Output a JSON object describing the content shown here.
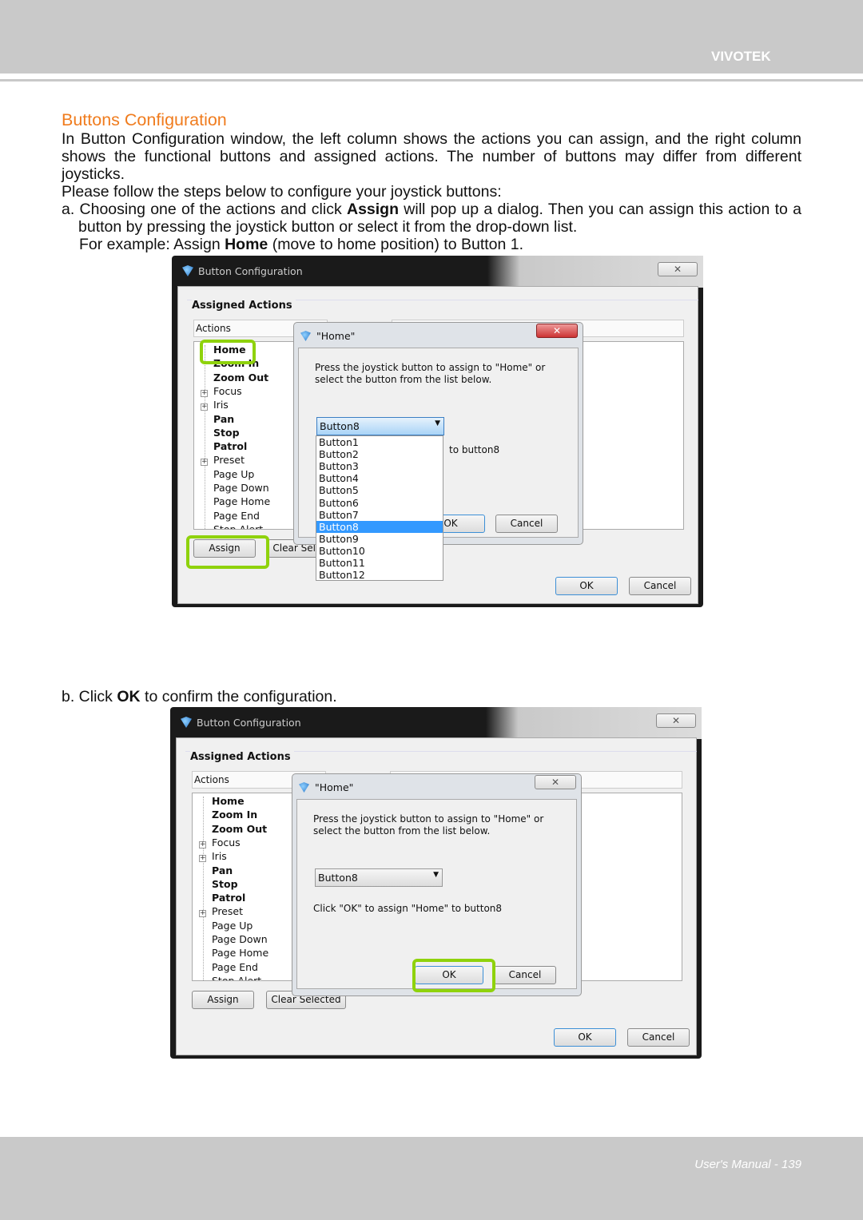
{
  "header": {
    "brand": "VIVOTEK"
  },
  "footer": {
    "page_label": "User's Manual - 139"
  },
  "section_title": "Buttons Configuration",
  "paragraphs": [
    "In Button Configuration window, the left column shows the actions you can assign, and the right column shows the functional buttons and assigned actions. The number of buttons may differ from different joysticks.",
    "Please follow the steps below to configure your joystick buttons:"
  ],
  "step_a": {
    "prefix": "a. Choosing one of the actions and click ",
    "bold": "Assign",
    "suffix": " will pop up a dialog. Then you can assign this action to a button by pressing the joystick button or select it from the drop-down list.",
    "example_prefix": "For example: Assign ",
    "example_bold": "Home",
    "example_suffix": " (move to home position) to Button 1."
  },
  "step_b": {
    "prefix": "b. Click ",
    "bold": "OK",
    "suffix": " to confirm the configuration."
  },
  "highlight_color": "#8fd20c",
  "accent_color": "#f07c1e",
  "window": {
    "title": "Button Configuration",
    "group_label": "Assigned Actions",
    "col_actions": "Actions",
    "tree": [
      {
        "label": "Home",
        "bold": true,
        "expand": false
      },
      {
        "label": "Zoom In",
        "bold": true,
        "expand": false
      },
      {
        "label": "Zoom Out",
        "bold": true,
        "expand": false
      },
      {
        "label": "Focus",
        "bold": false,
        "expand": true
      },
      {
        "label": "Iris",
        "bold": false,
        "expand": true
      },
      {
        "label": "Pan",
        "bold": true,
        "expand": false
      },
      {
        "label": "Stop",
        "bold": true,
        "expand": false
      },
      {
        "label": "Patrol",
        "bold": true,
        "expand": false
      },
      {
        "label": "Preset",
        "bold": false,
        "expand": true
      },
      {
        "label": "Page Up",
        "bold": false,
        "expand": false
      },
      {
        "label": "Page Down",
        "bold": false,
        "expand": false
      },
      {
        "label": "Page Home",
        "bold": false,
        "expand": false
      },
      {
        "label": "Page End",
        "bold": false,
        "expand": false
      },
      {
        "label": "Stop Alert",
        "bold": false,
        "expand": false
      }
    ],
    "assign": "Assign",
    "clear_selected": "Clear Selected",
    "ok": "OK",
    "cancel": "Cancel"
  },
  "dialog": {
    "title": "\"Home\"",
    "instruction_1": "Press the joystick button to assign to \"Home\" or",
    "instruction_2": "select the button from the list below.",
    "selected": "Button8",
    "confirm_text": "Click \"OK\" to assign \"Home\" to button8",
    "ok": "OK",
    "cancel": "Cancel",
    "options": [
      "Button1",
      "Button2",
      "Button3",
      "Button4",
      "Button5",
      "Button6",
      "Button7",
      "Button8",
      "Button9",
      "Button10",
      "Button11",
      "Button12"
    ]
  },
  "shots": [
    {
      "dropdown_open": true,
      "highlight": [
        "home",
        "assign"
      ]
    },
    {
      "dropdown_open": false,
      "highlight": [
        "dialog-ok"
      ]
    }
  ]
}
